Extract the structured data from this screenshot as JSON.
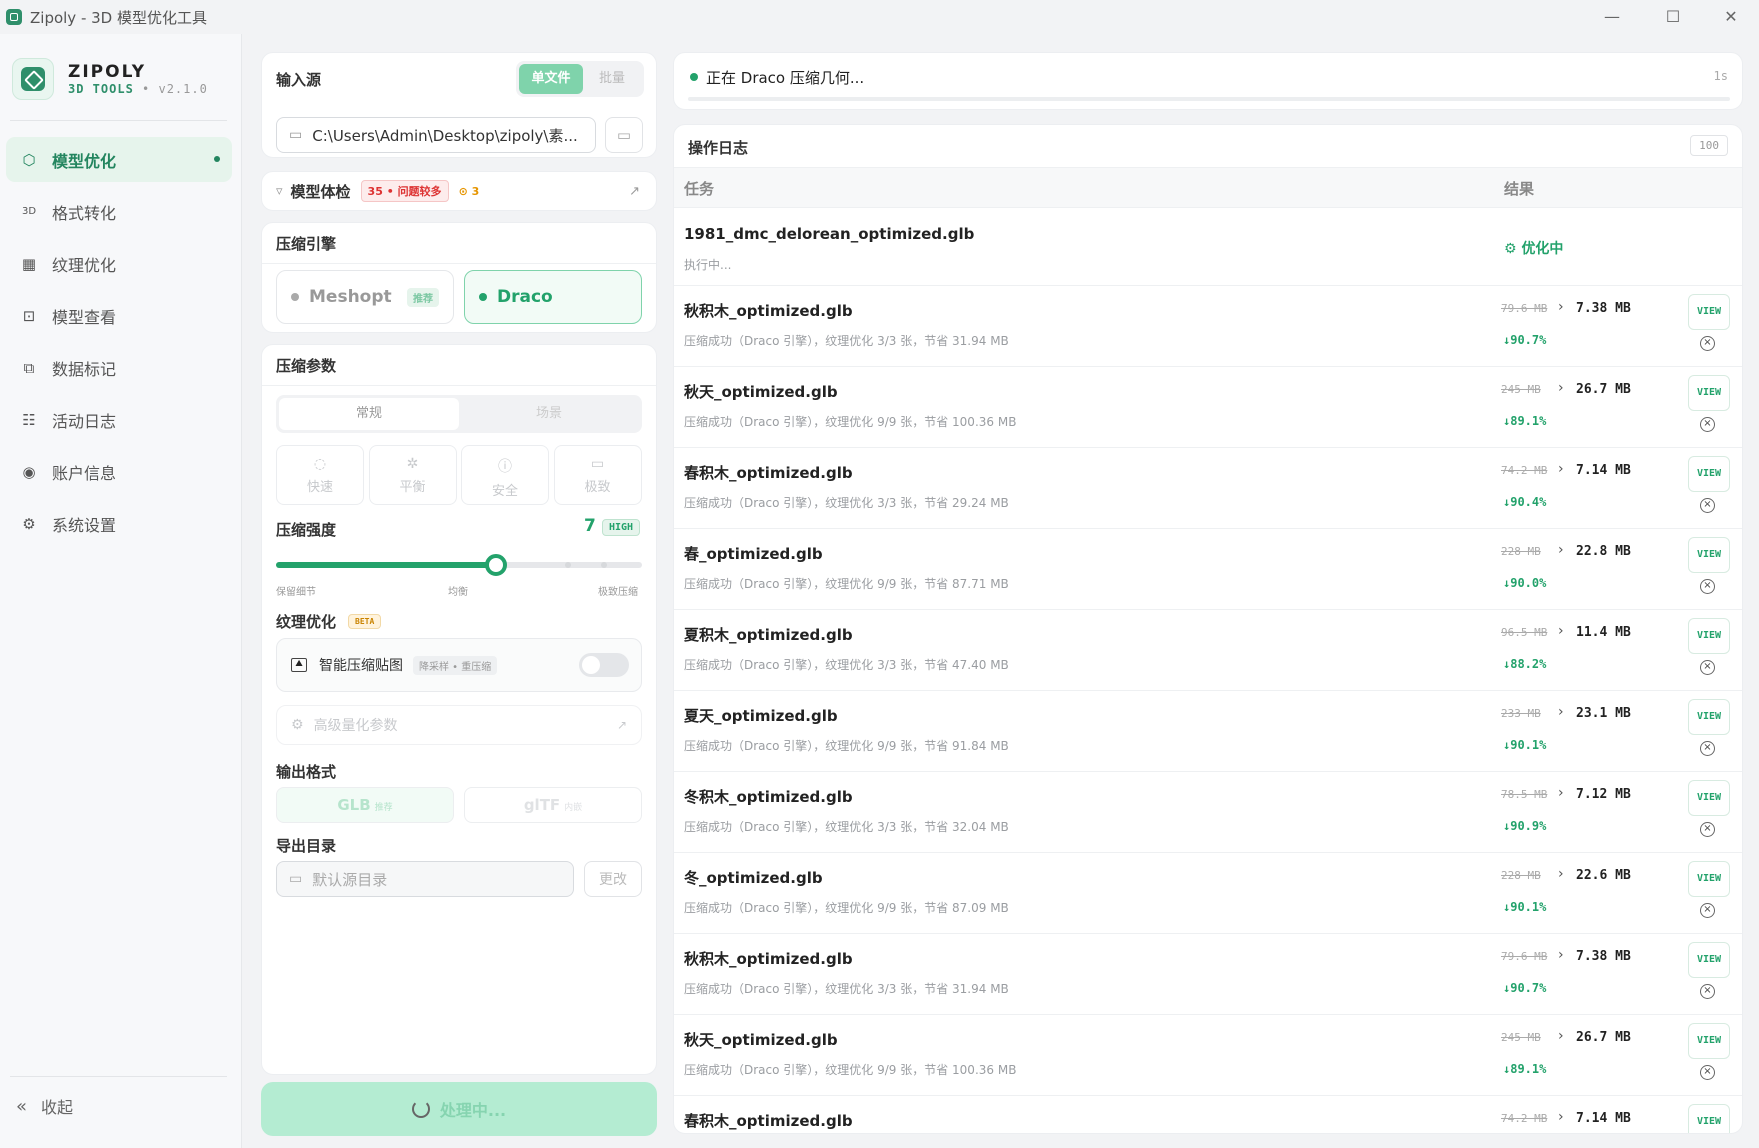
{
  "window": {
    "title": "Zipoly - 3D 模型优化工具",
    "min": "—",
    "max": "☐",
    "close": "✕"
  },
  "brand": {
    "name": "ZIPOLY",
    "sub": "3D TOOLS",
    "version": "• v2.1.0"
  },
  "nav": [
    {
      "label": "模型优化",
      "icon": "cube-icon",
      "glyph": "⬡",
      "active": true
    },
    {
      "label": "格式转化",
      "icon": "3d-icon",
      "glyph": "3D",
      "active": false
    },
    {
      "label": "纹理优化",
      "icon": "checker-icon",
      "glyph": "▦",
      "active": false
    },
    {
      "label": "模型查看",
      "icon": "scan-icon",
      "glyph": "⊡",
      "active": false
    },
    {
      "label": "数据标记",
      "icon": "tag-icon",
      "glyph": "⧉",
      "active": false
    },
    {
      "label": "活动日志",
      "icon": "log-icon",
      "glyph": "☷",
      "active": false
    },
    {
      "label": "账户信息",
      "icon": "user-icon",
      "glyph": "◉",
      "active": false
    },
    {
      "label": "系统设置",
      "icon": "gear-icon",
      "glyph": "⚙",
      "active": false
    }
  ],
  "collapse_label": "收起",
  "input": {
    "title": "输入源",
    "mode_single": "单文件",
    "mode_batch": "批量",
    "path": "C:\\Users\\Admin\\Desktop\\zipoly\\素..."
  },
  "check": {
    "title": "模型体检",
    "count": "35",
    "issues": "问题较多",
    "warn": "3"
  },
  "engine": {
    "title": "压缩引擎",
    "meshopt": "Meshopt",
    "recommend": "推荐",
    "draco": "Draco"
  },
  "params": {
    "title": "压缩参数",
    "tab_normal": "常规",
    "tab_scene": "场景",
    "modes": [
      {
        "label": "快速",
        "glyph": "◌"
      },
      {
        "label": "平衡",
        "glyph": "✲"
      },
      {
        "label": "安全",
        "glyph": "ⓘ"
      },
      {
        "label": "极致",
        "glyph": "▭"
      }
    ],
    "strength_label": "压缩强度",
    "strength_value": "7",
    "strength_badge": "HIGH",
    "strength_level": 0.7,
    "lbl_left": "保留细节",
    "lbl_mid": "均衡",
    "lbl_right": "极致压缩"
  },
  "texture": {
    "title": "纹理优化",
    "beta": "BETA",
    "smart": "智能压缩贴图",
    "tag": "降采样 • 重压缩",
    "advanced": "高级量化参数"
  },
  "output": {
    "title": "输出格式",
    "glb": "GLB",
    "glb_tag": "推荐",
    "gltf": "glTF",
    "gltf_tag": "内嵌"
  },
  "export": {
    "title": "导出目录",
    "placeholder": "默认源目录",
    "change": "更改"
  },
  "process_label": "处理中...",
  "status": {
    "text": "正在 Draco 压缩几何...",
    "time": "1s"
  },
  "log": {
    "title": "操作日志",
    "count": "100",
    "col_task": "任务",
    "col_result": "结果"
  },
  "running": {
    "name": "1981_dmc_delorean_optimized.glb",
    "sub": "执行中...",
    "status": "优化中"
  },
  "rows": [
    {
      "name": "秋积木_optimized.glb",
      "sub": "压缩成功（Draco 引擎），纹理优化 3/3 张，节省 31.94 MB",
      "old": "79.6 MB",
      "new": "7.38 MB",
      "pct": "90.7%"
    },
    {
      "name": "秋天_optimized.glb",
      "sub": "压缩成功（Draco 引擎），纹理优化 9/9 张，节省 100.36 MB",
      "old": "245 MB",
      "new": "26.7 MB",
      "pct": "89.1%"
    },
    {
      "name": "春积木_optimized.glb",
      "sub": "压缩成功（Draco 引擎），纹理优化 3/3 张，节省 29.24 MB",
      "old": "74.2 MB",
      "new": "7.14 MB",
      "pct": "90.4%"
    },
    {
      "name": "春_optimized.glb",
      "sub": "压缩成功（Draco 引擎），纹理优化 9/9 张，节省 87.71 MB",
      "old": "228 MB",
      "new": "22.8 MB",
      "pct": "90.0%"
    },
    {
      "name": "夏积木_optimized.glb",
      "sub": "压缩成功（Draco 引擎），纹理优化 3/3 张，节省 47.40 MB",
      "old": "96.5 MB",
      "new": "11.4 MB",
      "pct": "88.2%"
    },
    {
      "name": "夏天_optimized.glb",
      "sub": "压缩成功（Draco 引擎），纹理优化 9/9 张，节省 91.84 MB",
      "old": "233 MB",
      "new": "23.1 MB",
      "pct": "90.1%"
    },
    {
      "name": "冬积木_optimized.glb",
      "sub": "压缩成功（Draco 引擎），纹理优化 3/3 张，节省 32.04 MB",
      "old": "78.5 MB",
      "new": "7.12 MB",
      "pct": "90.9%"
    },
    {
      "name": "冬_optimized.glb",
      "sub": "压缩成功（Draco 引擎），纹理优化 9/9 张，节省 87.09 MB",
      "old": "228 MB",
      "new": "22.6 MB",
      "pct": "90.1%"
    },
    {
      "name": "秋积木_optimized.glb",
      "sub": "压缩成功（Draco 引擎），纹理优化 3/3 张，节省 31.94 MB",
      "old": "79.6 MB",
      "new": "7.38 MB",
      "pct": "90.7%"
    },
    {
      "name": "秋天_optimized.glb",
      "sub": "压缩成功（Draco 引擎），纹理优化 9/9 张，节省 100.36 MB",
      "old": "245 MB",
      "new": "26.7 MB",
      "pct": "89.1%"
    },
    {
      "name": "春积木_optimized.glb",
      "sub": "",
      "old": "74.2 MB",
      "new": "7.14 MB",
      "pct": ""
    }
  ],
  "view_label": "VIEW",
  "colors": {
    "accent": "#23a26b",
    "accent_bg": "#e6f4ec",
    "process_bg": "#b4ecd2"
  }
}
